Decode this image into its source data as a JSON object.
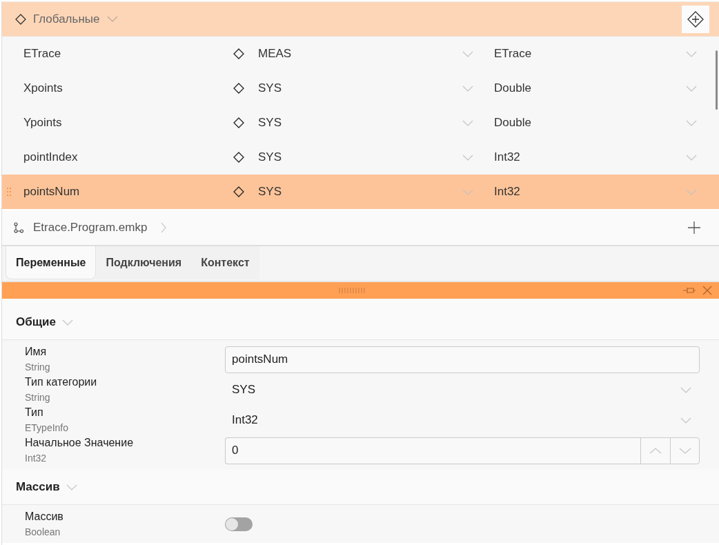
{
  "globals": {
    "title": "Глобальные"
  },
  "variables": [
    {
      "name": "ETrace",
      "category": "MEAS",
      "type": "ETrace",
      "selected": false
    },
    {
      "name": "Xpoints",
      "category": "SYS",
      "type": "Double",
      "selected": false
    },
    {
      "name": "Ypoints",
      "category": "SYS",
      "type": "Double",
      "selected": false
    },
    {
      "name": "pointIndex",
      "category": "SYS",
      "type": "Int32",
      "selected": false
    },
    {
      "name": "pointsNum",
      "category": "SYS",
      "type": "Int32",
      "selected": true
    }
  ],
  "breadcrumb": {
    "path": "Etrace.Program.emkp"
  },
  "tabs": [
    {
      "label": "Переменные",
      "selected": true
    },
    {
      "label": "Подключения",
      "selected": false
    },
    {
      "label": "Контекст",
      "selected": false
    }
  ],
  "sections": [
    {
      "title": "Общие",
      "properties": [
        {
          "kind": "text",
          "label": "Имя",
          "type": "String",
          "value": "pointsNum"
        },
        {
          "kind": "dropdown",
          "label": "Тип категории",
          "type": "String",
          "value": "SYS"
        },
        {
          "kind": "dropdown",
          "label": "Тип",
          "type": "ETypeInfo",
          "value": "Int32"
        },
        {
          "kind": "number",
          "label": "Начальное Значение",
          "type": "Int32",
          "value": "0"
        }
      ]
    },
    {
      "title": "Массив",
      "properties": [
        {
          "kind": "toggle",
          "label": "Массив",
          "type": "Boolean",
          "on": false
        }
      ]
    }
  ]
}
